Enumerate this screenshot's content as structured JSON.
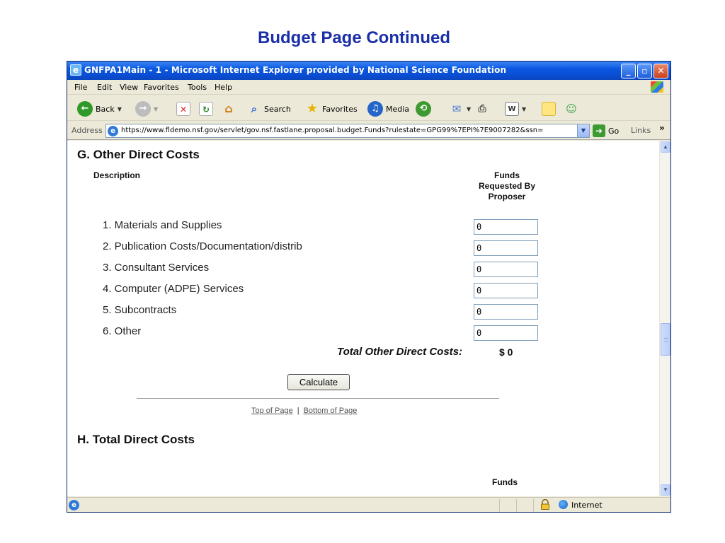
{
  "slide": {
    "title": "Budget Page Continued"
  },
  "window": {
    "title": "GNFPA1Main - 1 - Microsoft Internet Explorer provided by National Science Foundation",
    "controls": {
      "minimize": "_",
      "maximize": "▫",
      "close": "✕"
    }
  },
  "menu": [
    "File",
    "Edit",
    "View",
    "Favorites",
    "Tools",
    "Help"
  ],
  "toolbar": {
    "back_label": "Back",
    "search_label": "Search",
    "favorites_label": "Favorites",
    "media_label": "Media"
  },
  "address": {
    "label": "Address",
    "url": "https://www.fldemo.nsf.gov/servlet/gov.nsf.fastlane.proposal.budget.Funds?rulestate=GPG99%7EPI%7E9007282&ssn=",
    "go_label": "Go",
    "links_label": "Links"
  },
  "section_g": {
    "heading": "G. Other Direct Costs",
    "description_header": "Description",
    "funds_header": [
      "Funds",
      "Requested By",
      "Proposer"
    ],
    "rows": [
      {
        "label": "1.  Materials and Supplies",
        "value": "0"
      },
      {
        "label": "2.  Publication Costs/Documentation/distrib",
        "value": "0"
      },
      {
        "label": "3.  Consultant Services",
        "value": "0"
      },
      {
        "label": "4.  Computer (ADPE) Services",
        "value": "0"
      },
      {
        "label": "5.  Subcontracts",
        "value": "0"
      },
      {
        "label": "6.  Other",
        "value": "0"
      }
    ],
    "total_label": "Total Other Direct Costs:",
    "total_value": "$ 0",
    "calculate_label": "Calculate",
    "top_link": "Top of Page",
    "separator": "|",
    "bottom_link": "Bottom of Page"
  },
  "section_h": {
    "heading": "H. Total Direct Costs",
    "funds_header_partial": "Funds"
  },
  "status": {
    "zone": "Internet"
  },
  "colors": {
    "title_blue": "#1a2fa8",
    "titlebar": "#0a58e0",
    "chrome": "#ece9d8"
  }
}
